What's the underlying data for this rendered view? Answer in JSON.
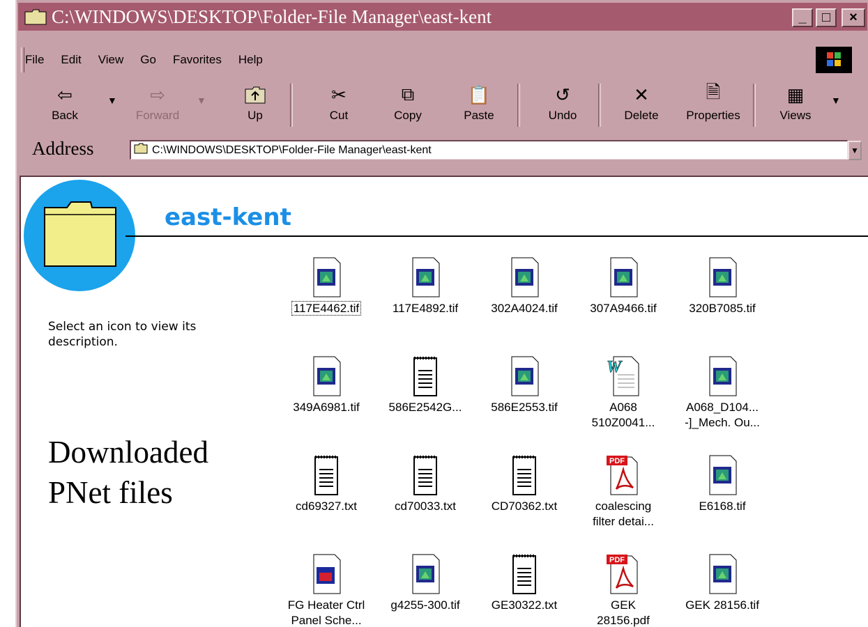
{
  "window": {
    "title": "C:\\WINDOWS\\DESKTOP\\Folder-File Manager\\east-kent",
    "controls": [
      "_",
      "□",
      "×"
    ]
  },
  "menu": [
    "File",
    "Edit",
    "View",
    "Go",
    "Favorites",
    "Help"
  ],
  "toolbar": {
    "back": "Back",
    "forward": "Forward",
    "up": "Up",
    "cut": "Cut",
    "copy": "Copy",
    "paste": "Paste",
    "undo": "Undo",
    "delete": "Delete",
    "properties": "Properties",
    "views": "Views"
  },
  "address": {
    "label": "Address",
    "value": "C:\\WINDOWS\\DESKTOP\\Folder-File Manager\\east-kent"
  },
  "folder": {
    "name": "east-kent",
    "description": "Select an icon to view its description.",
    "note": "Downloaded PNet files"
  },
  "files": [
    {
      "label": "117E4462.tif",
      "type": "tif"
    },
    {
      "label": "117E4892.tif",
      "type": "tif"
    },
    {
      "label": "302A4024.tif",
      "type": "tif"
    },
    {
      "label": "307A9466.tif",
      "type": "tif"
    },
    {
      "label": "320B7085.tif",
      "type": "tif"
    },
    {
      "label": "349A6981.tif",
      "type": "tif"
    },
    {
      "label": "586E2542G...",
      "type": "txt"
    },
    {
      "label": "586E2553.tif",
      "type": "tif"
    },
    {
      "label": "A068\n510Z0041...",
      "type": "doc"
    },
    {
      "label": "A068_D104...\n-]_Mech. Ou...",
      "type": "tif"
    },
    {
      "label": "cd69327.txt",
      "type": "txt"
    },
    {
      "label": "cd70033.txt",
      "type": "txt"
    },
    {
      "label": "CD70362.txt",
      "type": "txt"
    },
    {
      "label": "coalescing\nfilter detai...",
      "type": "pdf"
    },
    {
      "label": "E6168.tif",
      "type": "tif"
    },
    {
      "label": "FG Heater Ctrl\nPanel Sche...",
      "type": "img"
    },
    {
      "label": "g4255-300.tif",
      "type": "tif"
    },
    {
      "label": "GE30322.txt",
      "type": "txt"
    },
    {
      "label": "GEK\n28156.pdf",
      "type": "pdf"
    },
    {
      "label": "GEK 28156.tif",
      "type": "tif"
    }
  ],
  "colors": {
    "titlebar": "#a55a6d",
    "chrome": "#c7a1a9",
    "folder_circle": "#1ba3ec",
    "folder_name": "#1b8fe6"
  }
}
